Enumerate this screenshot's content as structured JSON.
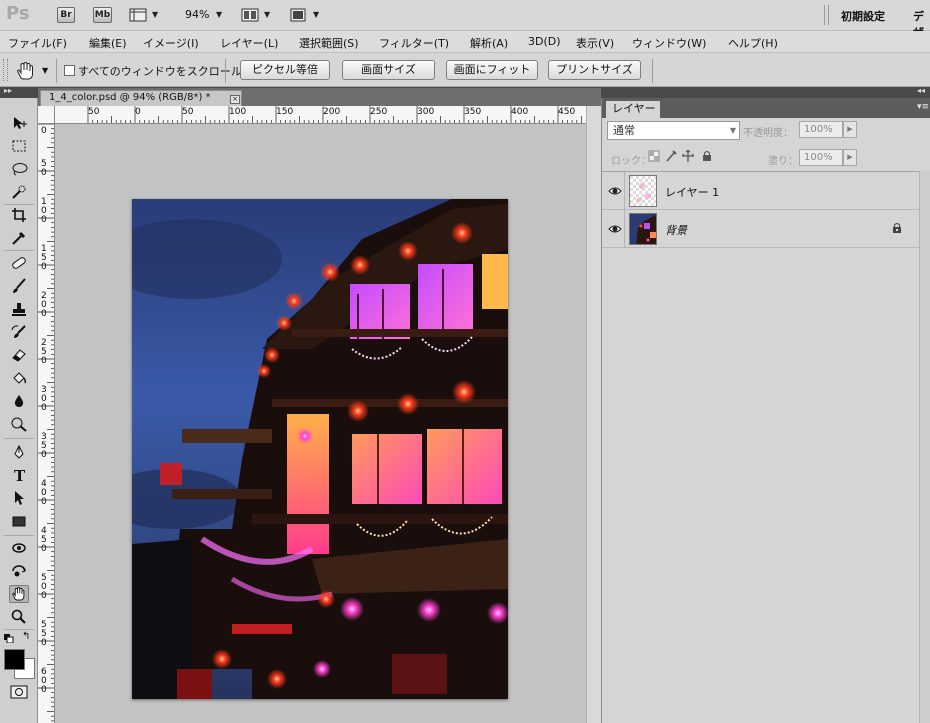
{
  "app": {
    "logo": "Ps",
    "bridge_label": "Br",
    "minibridge_label": "Mb",
    "zoom": "94%",
    "workspace": "初期設定",
    "workspace_next": "デザ"
  },
  "menu": [
    "ファイル(F)",
    "編集(E)",
    "イメージ(I)",
    "レイヤー(L)",
    "選択範囲(S)",
    "フィルター(T)",
    "解析(A)",
    "3D(D)",
    "表示(V)",
    "ウィンドウ(W)",
    "ヘルプ(H)"
  ],
  "options": {
    "scroll_all_label": "すべてのウィンドウをスクロール",
    "buttons": [
      "ピクセル等倍",
      "画面サイズ",
      "画面にフィット",
      "プリントサイズ"
    ]
  },
  "document": {
    "tab_title": "1_4_color.psd @ 94% (RGB/8*) *",
    "close_glyph": "×"
  },
  "rulers": {
    "h": [
      "50",
      "0",
      "50",
      "100",
      "150",
      "200",
      "250",
      "300",
      "350",
      "400",
      "450"
    ],
    "v": [
      "0",
      "5\n0",
      "1\n0\n0",
      "1\n5\n0",
      "2\n0\n0",
      "2\n5\n0",
      "3\n0\n0",
      "3\n5\n0",
      "4\n0\n0",
      "4\n5\n0",
      "5\n0\n0",
      "5\n5\n0",
      "6\n0\n0"
    ]
  },
  "layers_panel": {
    "tab_label": "レイヤー",
    "blend_mode": "通常",
    "opacity_label": "不透明度：",
    "opacity_value": "100%",
    "lock_label": "ロック：",
    "fill_label": "塗り：",
    "fill_value": "100%",
    "layers": [
      {
        "name": "レイヤー 1",
        "visible": true,
        "locked": false
      },
      {
        "name": "背景",
        "visible": true,
        "locked": true
      }
    ]
  },
  "colors": {
    "foreground": "#000000",
    "background": "#ffffff",
    "chrome_dark": "#4a4a4a"
  },
  "tools": [
    "move-icon",
    "marquee-icon",
    "lasso-icon",
    "quick-select-icon",
    "crop-icon",
    "eyedropper-icon",
    "healing-brush-icon",
    "brush-icon",
    "clone-stamp-icon",
    "history-brush-icon",
    "eraser-icon",
    "paint-bucket-icon",
    "blur-icon",
    "dodge-icon",
    "pen-icon",
    "type-icon",
    "path-select-icon",
    "rectangle-icon",
    "3d-rotate-icon",
    "3d-orbit-icon",
    "hand-icon",
    "zoom-icon"
  ]
}
